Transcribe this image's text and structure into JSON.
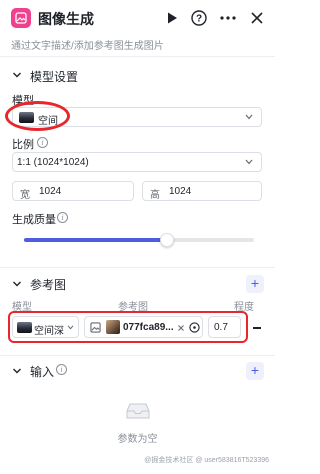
{
  "header": {
    "title": "图像生成",
    "description": "通过文字描述/添加参考图生成图片",
    "icon_color": "#f0418f"
  },
  "model_settings": {
    "section_title": "模型设置",
    "model_label": "模型",
    "model_value": "空间",
    "ratio_label": "比例",
    "ratio_value": "1:1 (1024*1024)",
    "width_label": "宽",
    "width_value": "1024",
    "height_label": "高",
    "height_value": "1024",
    "quality_label": "生成质量",
    "quality_value": 0.62
  },
  "reference": {
    "section_title": "参考图",
    "col_model": "模型",
    "col_image": "参考图",
    "col_strength": "程度",
    "model_value": "空间深",
    "image_name": "077fca89...",
    "strength_value": "0.7"
  },
  "input": {
    "section_title": "输入",
    "empty_text": "参数为空"
  },
  "watermark": "@掘金技术社区 @ user583816T523396",
  "colors": {
    "accent": "#4e5de0",
    "highlight": "#e8262b"
  }
}
